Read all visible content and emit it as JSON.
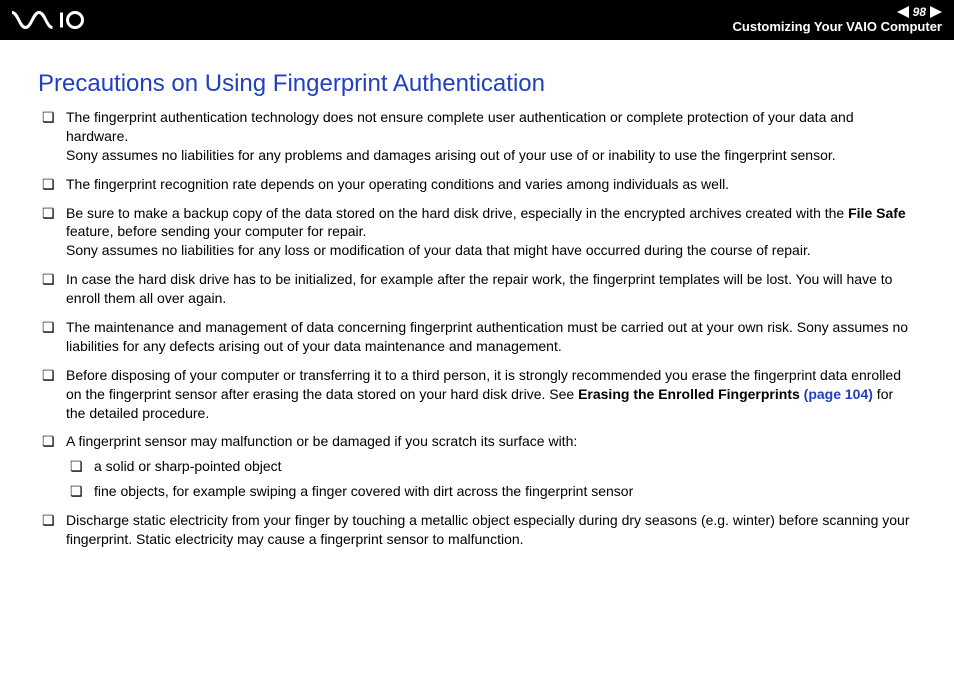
{
  "header": {
    "page_number": "98",
    "section": "Customizing Your VAIO Computer"
  },
  "title": "Precautions on Using Fingerprint Authentication",
  "items": [
    {
      "text": "The fingerprint authentication technology does not ensure complete user authentication or complete protection of your data and hardware.\nSony assumes no liabilities for any problems and damages arising out of your use of or inability to use the fingerprint sensor."
    },
    {
      "text": "The fingerprint recognition rate depends on your operating conditions and varies among individuals as well."
    },
    {
      "pre": "Be sure to make a backup copy of the data stored on the hard disk drive, especially in the encrypted archives created with the ",
      "bold1": "File Safe",
      "post": " feature, before sending your computer for repair.\nSony assumes no liabilities for any loss or modification of your data that might have occurred during the course of repair."
    },
    {
      "text": "In case the hard disk drive has to be initialized, for example after the repair work, the fingerprint templates will be lost. You will have to enroll them all over again."
    },
    {
      "text": "The maintenance and management of data concerning fingerprint authentication must be carried out at your own risk. Sony assumes no liabilities for any defects arising out of your data maintenance and management."
    },
    {
      "pre": "Before disposing of your computer or transferring it to a third person, it is strongly recommended you erase the fingerprint data enrolled on the fingerprint sensor after erasing the data stored on your hard disk drive. See ",
      "bold1": "Erasing the Enrolled Fingerprints ",
      "link": "(page 104)",
      "post": " for the detailed procedure."
    },
    {
      "text": "A fingerprint sensor may malfunction or be damaged if you scratch its surface with:",
      "sub": [
        "a solid or sharp-pointed object",
        "fine objects, for example swiping a finger covered with dirt across the fingerprint sensor"
      ]
    },
    {
      "text": "Discharge static electricity from your finger by touching a metallic object especially during dry seasons (e.g. winter) before scanning your fingerprint. Static electricity may cause a fingerprint sensor to malfunction."
    }
  ]
}
